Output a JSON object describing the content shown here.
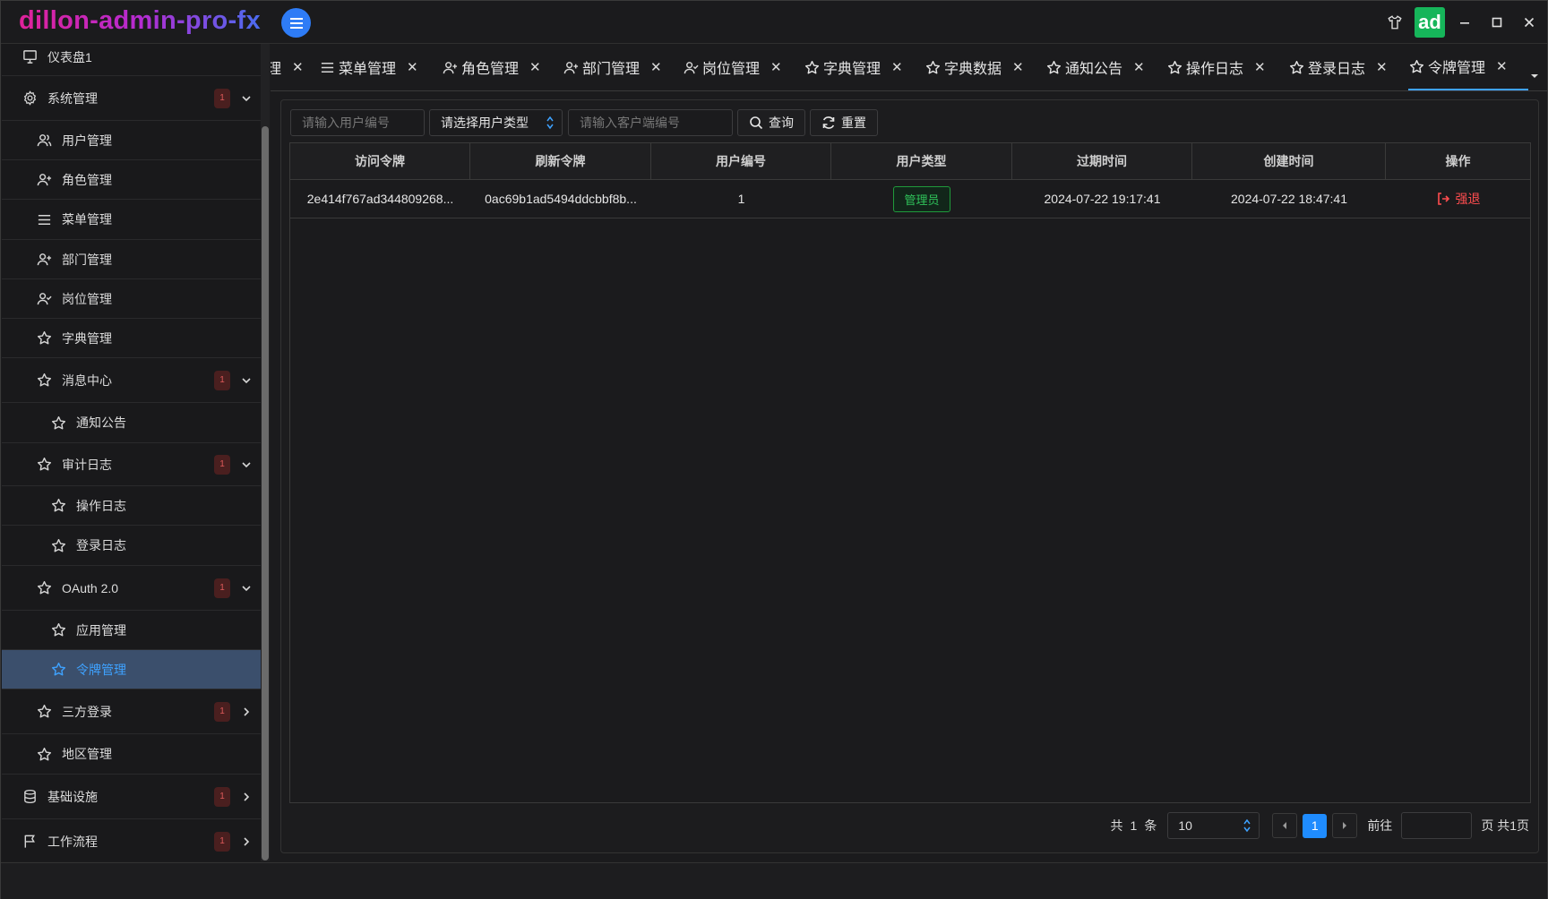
{
  "app": {
    "title": "dillon-admin-pro-fx",
    "avatar_text": "ad"
  },
  "sidebar": {
    "items": [
      {
        "label": "仪表盘1",
        "icon": "monitor-icon"
      },
      {
        "label": "系统管理",
        "icon": "gear-icon",
        "badge": "1",
        "chevron": "down"
      },
      {
        "label": "用户管理",
        "icon": "users-icon"
      },
      {
        "label": "角色管理",
        "icon": "user-plus-icon"
      },
      {
        "label": "菜单管理",
        "icon": "menu-lines-icon"
      },
      {
        "label": "部门管理",
        "icon": "user-plus-icon"
      },
      {
        "label": "岗位管理",
        "icon": "user-check-icon"
      },
      {
        "label": "字典管理",
        "icon": "star-icon"
      },
      {
        "label": "消息中心",
        "icon": "star-icon",
        "badge": "1",
        "chevron": "down"
      },
      {
        "label": "通知公告",
        "icon": "star-icon"
      },
      {
        "label": "审计日志",
        "icon": "star-icon",
        "badge": "1",
        "chevron": "down"
      },
      {
        "label": "操作日志",
        "icon": "star-icon"
      },
      {
        "label": "登录日志",
        "icon": "star-icon"
      },
      {
        "label": "OAuth 2.0",
        "icon": "star-icon",
        "badge": "1",
        "chevron": "down"
      },
      {
        "label": "应用管理",
        "icon": "star-icon"
      },
      {
        "label": "令牌管理",
        "icon": "star-icon",
        "active": true
      },
      {
        "label": "三方登录",
        "icon": "star-icon",
        "badge": "1",
        "chevron": "right"
      },
      {
        "label": "地区管理",
        "icon": "star-icon"
      },
      {
        "label": "基础设施",
        "icon": "database-icon",
        "badge": "1",
        "chevron": "right"
      },
      {
        "label": "工作流程",
        "icon": "flag-icon",
        "badge": "1",
        "chevron": "right"
      }
    ]
  },
  "tabs": [
    {
      "label": "理",
      "icon": ""
    },
    {
      "label": "菜单管理",
      "icon": "menu-lines-icon"
    },
    {
      "label": "角色管理",
      "icon": "user-plus-icon"
    },
    {
      "label": "部门管理",
      "icon": "user-plus-icon"
    },
    {
      "label": "岗位管理",
      "icon": "user-check-icon"
    },
    {
      "label": "字典管理",
      "icon": "star-icon"
    },
    {
      "label": "字典数据",
      "icon": "star-icon"
    },
    {
      "label": "通知公告",
      "icon": "star-icon"
    },
    {
      "label": "操作日志",
      "icon": "star-icon"
    },
    {
      "label": "登录日志",
      "icon": "star-icon"
    },
    {
      "label": "令牌管理",
      "icon": "star-icon",
      "active": true
    }
  ],
  "filters": {
    "user_no_placeholder": "请输入用户编号",
    "user_type_value": "请选择用户类型",
    "client_no_placeholder": "请输入客户端编号",
    "query_label": "查询",
    "reset_label": "重置"
  },
  "table": {
    "columns": [
      "访问令牌",
      "刷新令牌",
      "用户编号",
      "用户类型",
      "过期时间",
      "创建时间",
      "操作"
    ],
    "rows": [
      {
        "access_token": "2e414f767ad344809268...",
        "refresh_token": "0ac69b1ad5494ddcbbf8b...",
        "user_no": "1",
        "user_type": "管理员",
        "expire_time": "2024-07-22 19:17:41",
        "create_time": "2024-07-22 18:47:41",
        "action": "强退"
      }
    ]
  },
  "pagination": {
    "total_prefix": "共",
    "total": "1",
    "total_suffix": "条",
    "page_size": "10",
    "current_page": "1",
    "goto_label": "前往",
    "pages_label": "页 共1页"
  },
  "colors": {
    "accent": "#1f8cff",
    "danger": "#ff4d4f",
    "success": "#2fc35a",
    "avatar": "#16b55a"
  }
}
